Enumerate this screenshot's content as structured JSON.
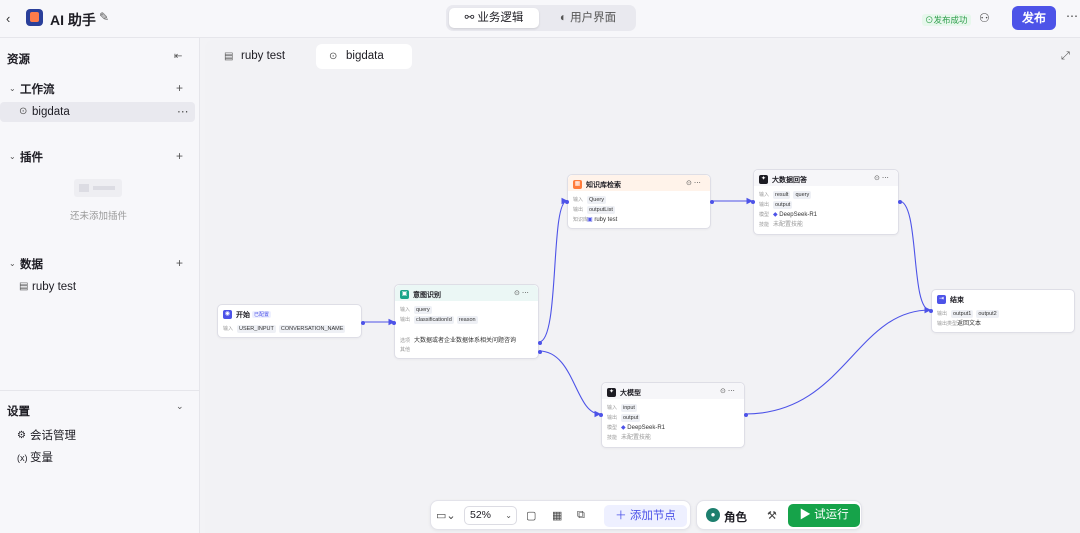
{
  "header": {
    "back_icon": "chevron-left-icon",
    "app_title": "AI 助手",
    "tabs": [
      {
        "label": "业务逻辑",
        "icon": "workflow-icon"
      },
      {
        "label": "用户界面",
        "icon": "palette-icon"
      }
    ],
    "publish_status": "发布成功",
    "publish_label": "发布"
  },
  "sidebar": {
    "title": "资源",
    "sections": {
      "workflow": {
        "label": "工作流",
        "items": [
          "bigdata"
        ]
      },
      "plugins": {
        "label": "插件",
        "empty_text": "还未添加插件"
      },
      "data": {
        "label": "数据",
        "items": [
          "ruby test"
        ]
      },
      "settings": {
        "label": "设置",
        "items": [
          {
            "label": "会话管理",
            "icon": "chat-gear-icon"
          },
          {
            "label": "变量",
            "icon": "variable-icon"
          }
        ]
      }
    }
  },
  "canvas": {
    "tabs": [
      "ruby test",
      "bigdata"
    ],
    "nodes": {
      "start": {
        "title": "开始",
        "badge": "已配置",
        "input_label": "输入",
        "inputs": [
          "USER_INPUT",
          "CONVERSATION_NAME"
        ]
      },
      "intent": {
        "title": "意图识别",
        "input_label": "输入",
        "inputs": [
          "query"
        ],
        "output_label": "输出",
        "outputs": [
          "classificationId",
          "reason"
        ],
        "option_label": "选项",
        "option": "大数据或者企业数据体系相关问题咨询",
        "other": "其他"
      },
      "knowledge": {
        "title": "知识库检索",
        "input_label": "输入",
        "inputs": [
          "Query"
        ],
        "output_label": "输出",
        "outputs": [
          "outputList"
        ],
        "kb_label": "知识库",
        "kb": "ruby test"
      },
      "bigdata_answer": {
        "title": "大数据回答",
        "input_label": "输入",
        "inputs": [
          "result",
          "query"
        ],
        "output_label": "输出",
        "outputs": [
          "output"
        ],
        "model_label": "模型",
        "model": "DeepSeek-R1",
        "skill_label": "技能",
        "skill": "未配置技能"
      },
      "llm": {
        "title": "大模型",
        "input_label": "输入",
        "inputs": [
          "input"
        ],
        "output_label": "输出",
        "outputs": [
          "output"
        ],
        "model_label": "模型",
        "model": "DeepSeek-R1",
        "skill_label": "技能",
        "skill": "未配置技能"
      },
      "end": {
        "title": "结束",
        "output_label": "输出",
        "outputs": [
          "output1",
          "output2"
        ],
        "type_label": "输出类型",
        "type": "返回文本"
      }
    }
  },
  "toolbar": {
    "zoom": "52%",
    "add_node": "添加节点",
    "role": "角色",
    "run": "试运行"
  },
  "colors": {
    "accent": "#4d53e8",
    "run": "#16a34a",
    "success": "#2e9e4b"
  }
}
